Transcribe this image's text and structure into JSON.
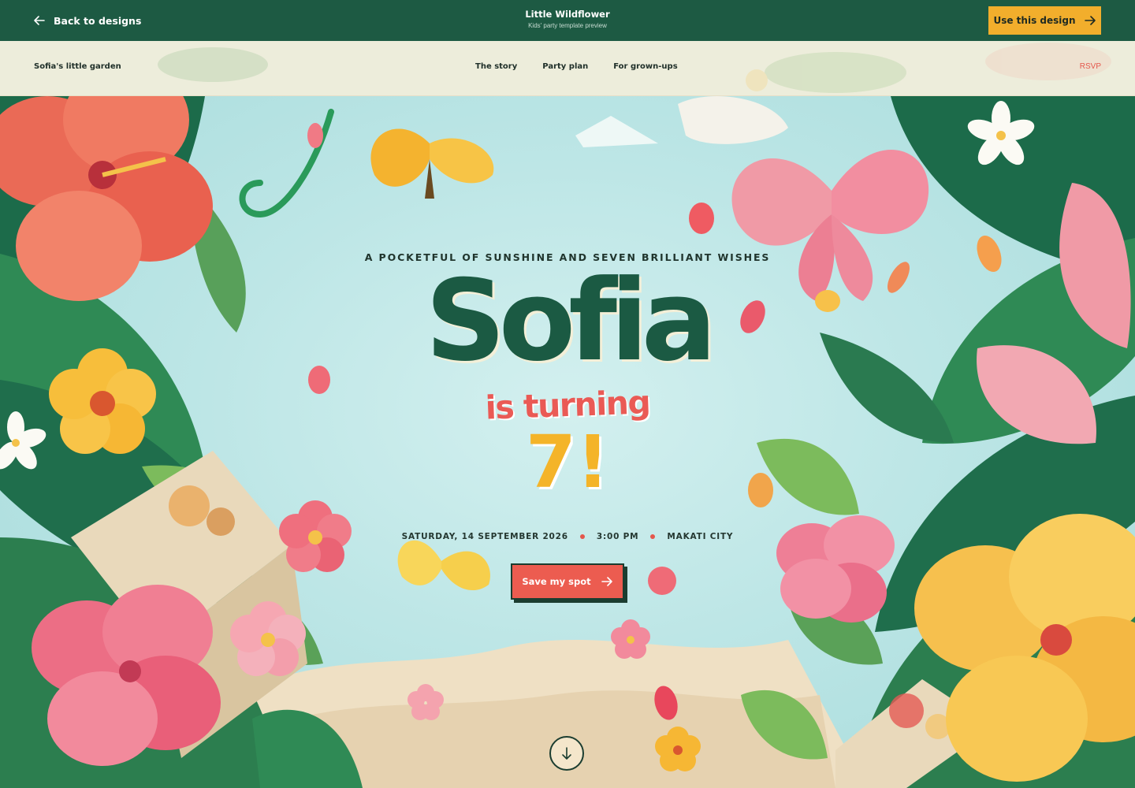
{
  "topbar": {
    "back_label": "Back to designs",
    "title": "Little Wildflower",
    "subtitle": "Kids' party template preview",
    "use_label": "Use this design",
    "icons": {
      "back": "arrow-left-icon",
      "use": "arrow-right-icon"
    }
  },
  "sitenav": {
    "brand": "Sofia's little garden",
    "links": [
      "The story",
      "Party plan",
      "For grown-ups"
    ],
    "rsvp": "RSVP"
  },
  "hero": {
    "eyebrow": "A POCKETFUL OF SUNSHINE AND SEVEN BRILLIANT WISHES",
    "name": "Sofia",
    "turning": "is turning",
    "age": "7!",
    "details": {
      "date": "SATURDAY, 14 SEPTEMBER 2026",
      "time": "3:00 PM",
      "location": "MAKATI CITY"
    },
    "cta_label": "Save my spot",
    "icons": {
      "cta": "arrow-right-icon",
      "scroll": "arrow-down-icon"
    }
  },
  "colors": {
    "brand_green": "#1d5a43",
    "accent_yellow": "#f2ae2c",
    "accent_coral": "#ec5c50",
    "sky": "#bde6e6",
    "cream": "#fffae8"
  }
}
